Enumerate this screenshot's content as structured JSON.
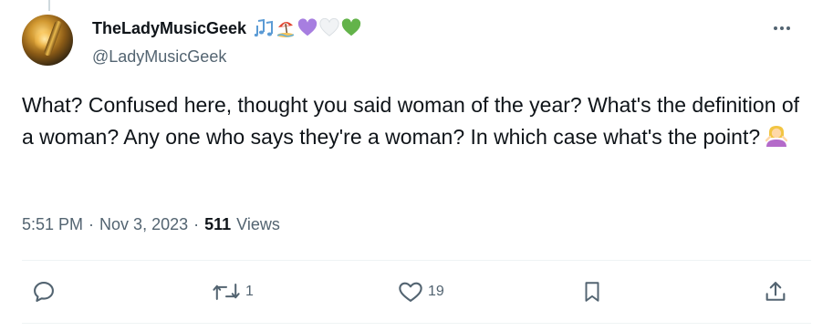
{
  "author": {
    "display_name": "TheLadyMusicGeek",
    "handle": "@LadyMusicGeek",
    "name_emojis": [
      "musical-notes",
      "beach-umbrella",
      "purple-heart",
      "white-heart",
      "green-heart"
    ]
  },
  "tweet": {
    "text": "What? Confused here, thought you said woman of the year? What's the definition of a woman? Any one who says they're a woman? In which case what's the point?",
    "trailing_emoji": "person-shrugging"
  },
  "meta": {
    "time": "5:51 PM",
    "separator": "·",
    "date": "Nov 3, 2023",
    "views_count": "511",
    "views_label": "Views"
  },
  "actions": {
    "reply_count": "",
    "repost_count": "1",
    "like_count": "19"
  },
  "colors": {
    "text": "#0f1419",
    "secondary": "#536471",
    "divider": "#eff3f4",
    "notes_blue": "#5b9bd5",
    "purple_heart": "#a77ee0",
    "green_heart": "#63b34a"
  }
}
